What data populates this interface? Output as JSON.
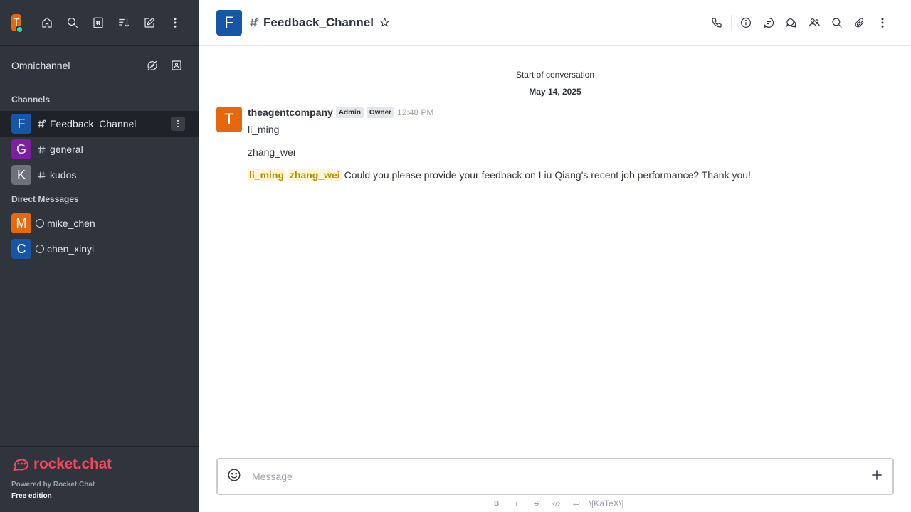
{
  "user": {
    "initial": "T",
    "color": "#e5680c",
    "status_color": "#2de0a5"
  },
  "sidebar": {
    "omnichannel_label": "Omnichannel",
    "channels_title": "Channels",
    "channels": [
      {
        "initial": "F",
        "name": "Feedback_Channel",
        "color": "#1557a6"
      },
      {
        "initial": "G",
        "name": "general",
        "color": "#7e1fa1"
      },
      {
        "initial": "K",
        "name": "kudos",
        "color": "#6c727a"
      }
    ],
    "dm_title": "Direct Messages",
    "dms": [
      {
        "initial": "M",
        "name": "mike_chen",
        "color": "#e5680c"
      },
      {
        "initial": "C",
        "name": "chen_xinyi",
        "color": "#1557a6"
      }
    ],
    "logo_text": "rocket.chat",
    "powered_by": "Powered by Rocket.Chat",
    "edition": "Free edition"
  },
  "header": {
    "initial": "F",
    "color": "#1557a6",
    "title": "Feedback_Channel"
  },
  "messages": {
    "start_text": "Start of conversation",
    "date": "May 14, 2025",
    "items": [
      {
        "initial": "T",
        "color": "#e5680c",
        "username": "theagentcompany",
        "badges": [
          "Admin",
          "Owner"
        ],
        "time": "12:48 PM",
        "line1": "li_ming",
        "line2": "zhang_wei",
        "mention1": "li_ming",
        "mention2": "zhang_wei",
        "text": "Could you please provide your feedback on Liu Qiang's recent job performance? Thank you!"
      }
    ]
  },
  "composer": {
    "placeholder": "Message",
    "katex_label": "\\[KaTeX\\]"
  }
}
